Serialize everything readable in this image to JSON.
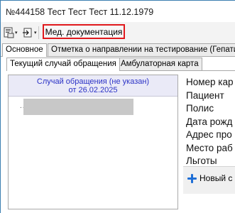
{
  "window": {
    "title": "№444158 Тест Тест Тест 11.12.1979"
  },
  "toolbar": {
    "print_icon": "document-print-icon",
    "export_icon": "export-arrow-icon",
    "caret": "▾",
    "med_doc_label": "Мед. документация",
    "highlight_color": "#e0191d"
  },
  "tabs_top": [
    {
      "label": "Основное",
      "active": true
    },
    {
      "label": "Отметка о направлении на тестирование (Гепатит",
      "active": false
    }
  ],
  "tabs_inner": [
    {
      "label": "Текущий случай обращения",
      "active": true
    },
    {
      "label": "Амбулаторная карта",
      "active": false
    }
  ],
  "tree": {
    "header_line1": "Случай обращения (не указан)",
    "header_line2": "от 26.02.2025",
    "header_color": "#2b32c6",
    "dots": "......"
  },
  "fields": [
    "Номер кар",
    "Пациент",
    "Полис",
    "Дата рожд",
    "Адрес про",
    "Место раб",
    "Льготы"
  ],
  "new_button": {
    "label": "Новый с",
    "icon": "plus-icon"
  }
}
